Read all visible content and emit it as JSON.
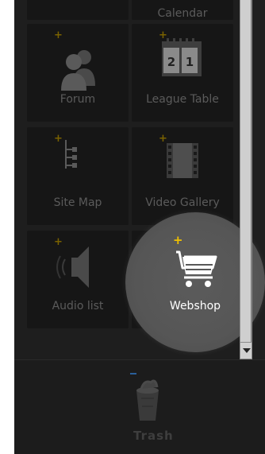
{
  "widgets": {
    "calendar": {
      "label": "Calendar"
    },
    "forum": {
      "label": "Forum"
    },
    "league_table": {
      "label": "League Table",
      "dates": [
        "2",
        "1"
      ]
    },
    "site_map": {
      "label": "Site Map"
    },
    "video_gallery": {
      "label": "Video Gallery"
    },
    "audio_list": {
      "label": "Audio list"
    },
    "webshop": {
      "label": "Webshop"
    }
  },
  "add_glyph": "+",
  "trash": {
    "label": "Trash"
  },
  "colors": {
    "panel_bg": "#1f1f1f",
    "tile_bg": "#161616",
    "tile_label": "#5b5b5b",
    "plus_dim": "#7a6200",
    "plus_active": "#f0c000",
    "spotlight": "#585858",
    "trash_minus": "#2a5f9a"
  }
}
